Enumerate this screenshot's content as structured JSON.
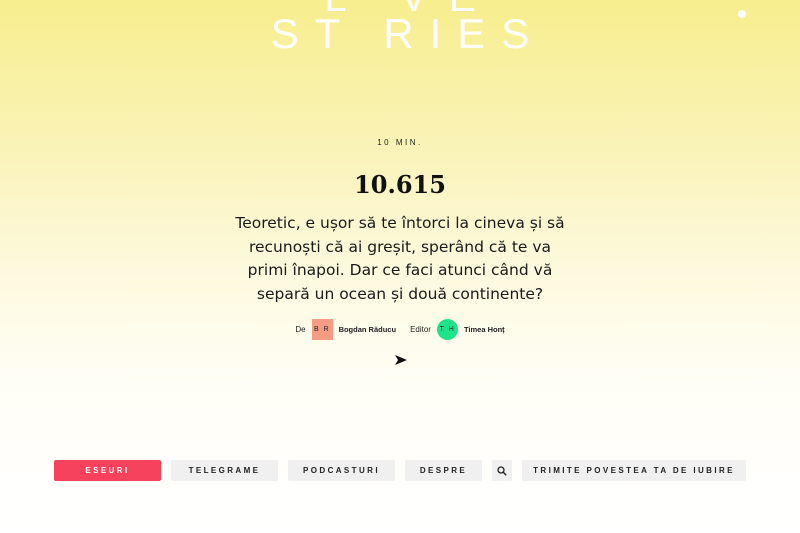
{
  "logo": {
    "line1": "L   VE",
    "line2": "ST  RIES"
  },
  "story": {
    "duration": "10 MIN.",
    "title": "10.615",
    "lede": "Teoretic, e ușor să te întorci la cineva și să recunoști că ai greșit, sperând că te va primi înapoi. Dar ce faci atunci când vă separă un ocean și două continente?",
    "author_label": "De",
    "author_initials": "B R",
    "author_name": "Bogdan Răducu",
    "editor_label": "Editor",
    "editor_initials": "T H",
    "editor_name": "Timea Honț"
  },
  "nav": {
    "items": [
      "ESEURI",
      "TELEGRAME",
      "PODCASTURI",
      "DESPRE"
    ],
    "active_index": 0,
    "submit_label": "TRIMITE POVESTEA TA DE IUBIRE"
  },
  "colors": {
    "accent": "#f6425c",
    "author_avatar": "#f79c84",
    "editor_avatar": "#1de38a",
    "background_top": "#f7ee8e"
  },
  "icons": [
    "menu-dot-icon",
    "play-arrow-icon",
    "search-icon"
  ]
}
